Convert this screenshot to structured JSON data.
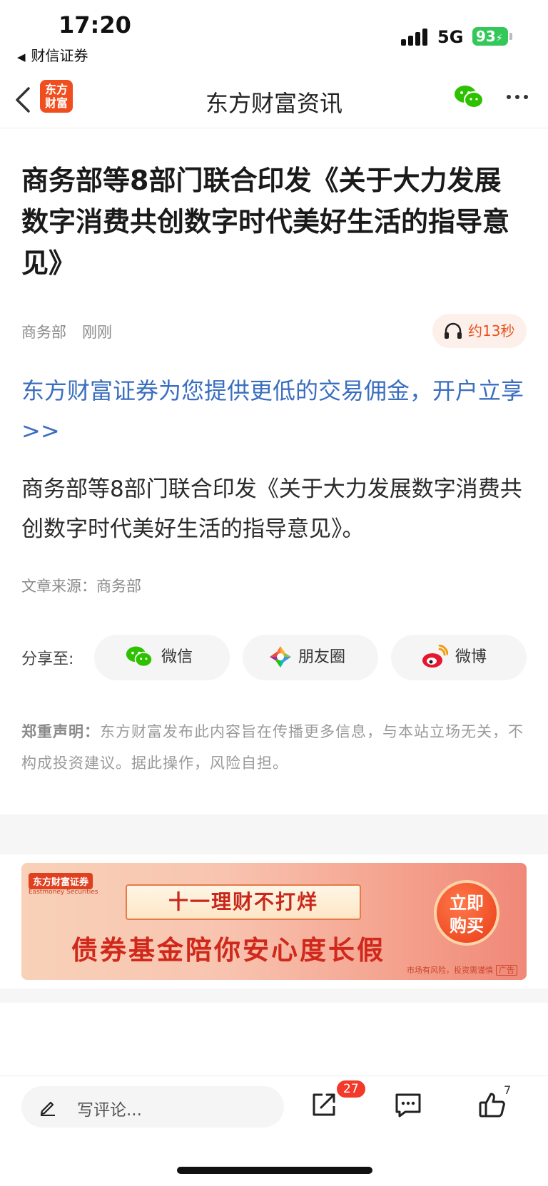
{
  "status_bar": {
    "time": "17:20",
    "back_app": "财信证券",
    "network": "5G",
    "battery": "93"
  },
  "nav": {
    "logo_text": "东方财富",
    "title": "东方财富资讯"
  },
  "article": {
    "headline": "商务部等8部门联合印发《关于大力发展数字消费共创数字时代美好生活的指导意见》",
    "source_name": "商务部",
    "time_ago": "刚刚",
    "audio_duration": "约13秒",
    "promo_link": "东方财富证券为您提供更低的交易佣金，开户立享>>",
    "body": "商务部等8部门联合印发《关于大力发展数字消费共创数字时代美好生活的指导意见》。",
    "source_line": "文章来源：商务部"
  },
  "share": {
    "label": "分享至:",
    "buttons": [
      {
        "label": "微信",
        "icon": "wechat-icon"
      },
      {
        "label": "朋友圈",
        "icon": "moments-icon"
      },
      {
        "label": "微博",
        "icon": "weibo-icon"
      }
    ]
  },
  "disclaimer": {
    "title": "郑重声明：",
    "text": "东方财富发布此内容旨在传播更多信息，与本站立场无关，不构成投资建议。据此操作，风险自担。"
  },
  "banner": {
    "brand": "东方财富证券",
    "brand_sub": "Eastmoney Securities",
    "scroll_text": "十一理财不打烊",
    "main_text": "债券基金陪你安心度长假",
    "cta": "立即购买",
    "risk_text": "市场有风险，投资需谨慎",
    "ad_tag": "广告"
  },
  "bottom_bar": {
    "comment_placeholder": "写评论...",
    "share_count": "27",
    "like_count": "7"
  },
  "colors": {
    "brand_orange": "#f04e1e",
    "link_blue": "#3a6ec0",
    "badge_red": "#f2392a",
    "wechat_green": "#2dc100"
  }
}
